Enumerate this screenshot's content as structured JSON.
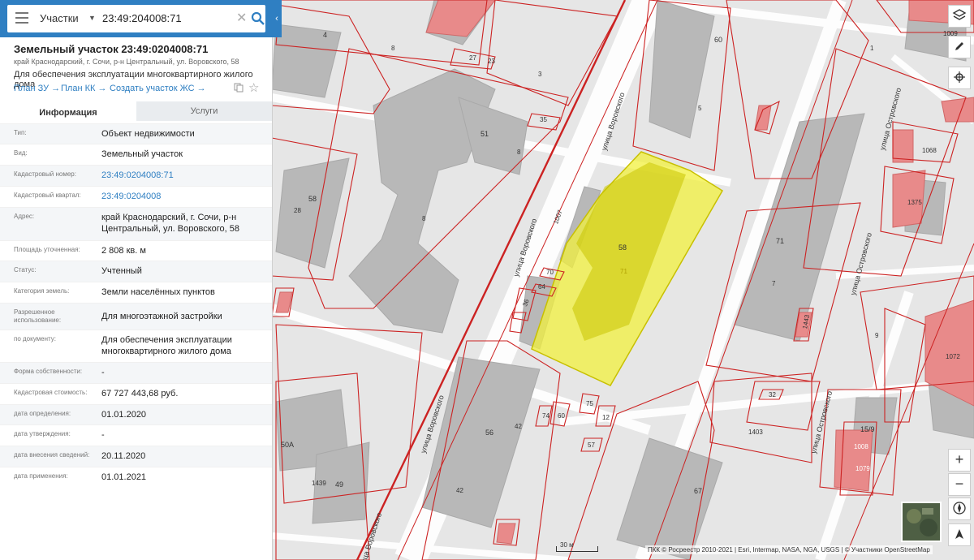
{
  "search": {
    "layer": "Участки",
    "value": "23:49:204008:71",
    "clear_label": "✕",
    "collapse_label": "‹"
  },
  "object": {
    "title": "Земельный участок 23:49:0204008:71",
    "address": "край Краснодарский, г. Сочи, р-н Центральный, ул. Воровского, 58",
    "purpose": "Для обеспечения эксплуатации многоквартирного жилого дома",
    "links": [
      "План ЗУ →",
      "План КК →",
      "Создать участок ЖС →"
    ]
  },
  "tabs": [
    "Информация",
    "Услуги"
  ],
  "fields": [
    {
      "label": "Тип:",
      "value": "Объект недвижимости"
    },
    {
      "label": "Вид:",
      "value": "Земельный участок"
    },
    {
      "label": "Кадастровый номер:",
      "value": "23:49:0204008:71"
    },
    {
      "label": "Кадастровый квартал:",
      "value": "23:49:0204008"
    },
    {
      "label": "Адрес:",
      "value": "край Краснодарский, г. Сочи, р-н Центральный, ул. Воровского, 58"
    },
    {
      "label": "Площадь уточненная:",
      "value": "2 808 кв. м"
    },
    {
      "label": "Статус:",
      "value": "Учтенный"
    },
    {
      "label": "Категория земель:",
      "value": "Земли населённых пунктов"
    },
    {
      "label": "Разрешенное использование:",
      "value": "Для многоэтажной застройки"
    },
    {
      "label": "по документу:",
      "value": "Для обеспечения эксплуатации многоквартирного жилого дома"
    },
    {
      "label": "Форма собственности:",
      "value": "-"
    },
    {
      "label": "Кадастровая стоимость:",
      "value": "67 727 443,68 руб."
    },
    {
      "label": "дата определения:",
      "value": "01.01.2020"
    },
    {
      "label": "дата утверждения:",
      "value": "-"
    },
    {
      "label": "дата внесения сведений:",
      "value": "20.11.2020"
    },
    {
      "label": "дата применения:",
      "value": "01.01.2021"
    }
  ],
  "map": {
    "labels": {
      "l_4": "4",
      "l_60": "60",
      "l_8a": "8",
      "l_5": "5",
      "l_51": "51",
      "l_8b": "8",
      "l_8c": "8",
      "l_58a": "58",
      "l_28": "28",
      "l_71": "71",
      "l_58b": "58",
      "l_71b": "71",
      "l_7": "7",
      "l_9": "9",
      "l_1072": "1072",
      "l_1068": "1068",
      "l_1009": "1009",
      "l_1375": "1375",
      "l_56": "56",
      "l_42a": "42",
      "l_42b": "42",
      "l_67": "67",
      "l_50a": "50А",
      "l_49": "49",
      "l_1439": "1439",
      "l_1403": "1403",
      "l_15_9": "15/9",
      "l_1008": "1008",
      "l_1079": "1079",
      "l_32": "32",
      "l_75": "75",
      "l_74": "74",
      "l_60b": "60",
      "l_12": "12",
      "l_57": "57",
      "l_35": "35",
      "l_27": "27",
      "l_23": "23",
      "l_3": "3",
      "l_1007": "1007",
      "l_70": "70",
      "l_64": "64",
      "l_36": "36",
      "l_1443": "1443",
      "l_1": "1"
    },
    "streets": {
      "s1": "улица Воровского",
      "s2": "улица Воровского",
      "s3": "улица Воровского",
      "s4": "улица Островского",
      "s5": "улица Островского",
      "s6": "улица Островского",
      "s7": "улица Воровского"
    },
    "scale": "30 м",
    "attribution": "ПКК © Росреестр 2010-2021 | Esri, Intermap, NASA, NGA, USGS | © Участники OpenStreetMap",
    "controls": {
      "zoom_in": "+",
      "zoom_out": "−"
    }
  }
}
